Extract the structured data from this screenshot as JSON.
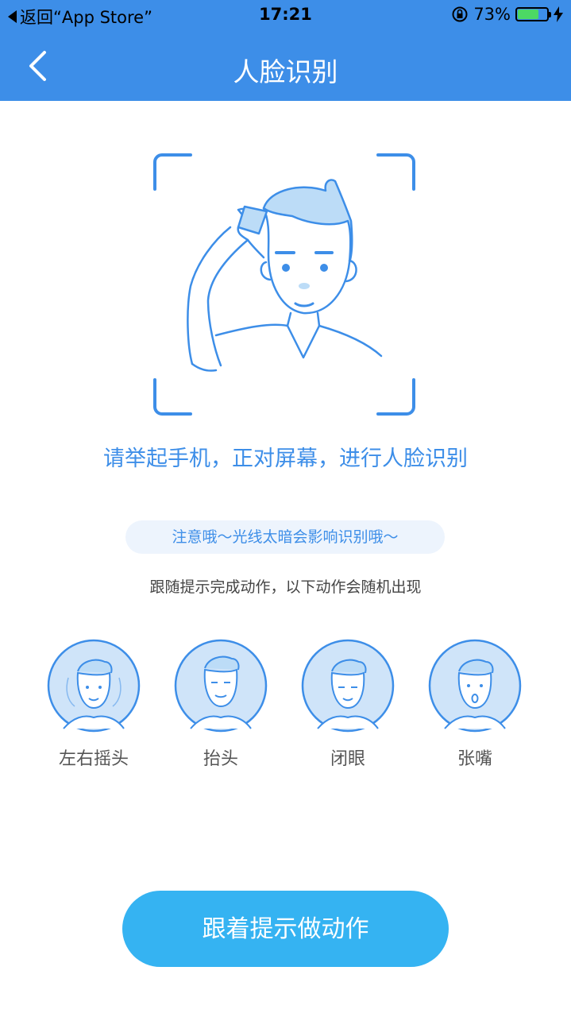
{
  "status_bar": {
    "back_app": "返回“App Store”",
    "time": "17:21",
    "battery_percent": "73%",
    "battery_level": 0.73
  },
  "nav": {
    "title": "人脸识别",
    "back_icon": "chevron-left-icon"
  },
  "instruction": "请举起手机，正对屏幕，进行人脸识别",
  "notice": "注意哦～光线太暗会影响识别哦～",
  "subtext": "跟随提示完成动作，以下动作会随机出现",
  "actions": [
    {
      "label": "左右摇头"
    },
    {
      "label": "抬头"
    },
    {
      "label": "闭眼"
    },
    {
      "label": "张嘴"
    }
  ],
  "cta_label": "跟着提示做动作",
  "colors": {
    "primary": "#3d8ee8",
    "button": "#35b3f2",
    "notice_bg": "#edf4fd",
    "battery": "#4cd964"
  }
}
